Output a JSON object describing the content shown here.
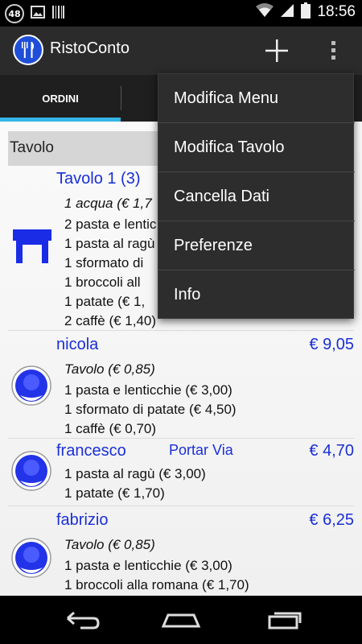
{
  "status_bar": {
    "notification_count": "48",
    "time": "18:56",
    "icons": [
      "notification-count-icon",
      "image-icon",
      "barcode-icon",
      "wifi-icon",
      "signal-icon",
      "battery-icon"
    ]
  },
  "action_bar": {
    "title": "RistoConto",
    "icons": [
      "restaurant-icon",
      "add-icon",
      "overflow-menu-icon"
    ]
  },
  "tabs": [
    {
      "label": "ORDINI",
      "selected": true
    }
  ],
  "section_header": "Tavolo",
  "orders": [
    {
      "name": "Tavolo 1 (3)",
      "takeaway": "",
      "total": "",
      "avatar": "table-icon",
      "lines": [
        {
          "text": "1 acqua (€ 1,7",
          "italic": true
        },
        {
          "text": "2 pasta e lentic",
          "italic": false
        },
        {
          "text": "1 pasta al ragù",
          "italic": false
        },
        {
          "text": "1 sformato di",
          "italic": false
        },
        {
          "text": "1 broccoli all",
          "italic": false
        },
        {
          "text": "1 patate (€ 1,",
          "italic": false
        },
        {
          "text": "2 caffè (€ 1,40)",
          "italic": false
        }
      ]
    },
    {
      "name": "nicola",
      "takeaway": "",
      "total": "€ 9,05",
      "avatar": "person-icon",
      "lines": [
        {
          "text": "Tavolo (€ 0,85)",
          "italic": true
        },
        {
          "text": "1 pasta e lenticchie (€ 3,00)",
          "italic": false
        },
        {
          "text": "1 sformato di patate (€ 4,50)",
          "italic": false
        },
        {
          "text": "1 caffè (€ 0,70)",
          "italic": false
        }
      ]
    },
    {
      "name": "francesco",
      "takeaway": "Portar Via",
      "total": "€ 4,70",
      "avatar": "person-icon",
      "lines": [
        {
          "text": "1 pasta al ragù (€ 3,00)",
          "italic": false
        },
        {
          "text": "1 patate (€ 1,70)",
          "italic": false
        }
      ]
    },
    {
      "name": "fabrizio",
      "takeaway": "",
      "total": "€ 6,25",
      "avatar": "person-icon",
      "lines": [
        {
          "text": "Tavolo (€ 0,85)",
          "italic": true
        },
        {
          "text": "1 pasta e lenticchie (€ 3,00)",
          "italic": false
        },
        {
          "text": "1 broccoli alla romana (€ 1,70)",
          "italic": false
        }
      ]
    }
  ],
  "menu": [
    {
      "label": "Modifica Menu"
    },
    {
      "label": "Modifica Tavolo"
    },
    {
      "label": "Cancella Dati"
    },
    {
      "label": "Preferenze"
    },
    {
      "label": "Info"
    }
  ],
  "nav_bar": {
    "icons": [
      "back-icon",
      "home-icon",
      "recent-apps-icon"
    ]
  },
  "colors": {
    "accent": "#33b5e5",
    "item_text": "#1a2fd6",
    "avatar_blue": "#2233e8"
  }
}
